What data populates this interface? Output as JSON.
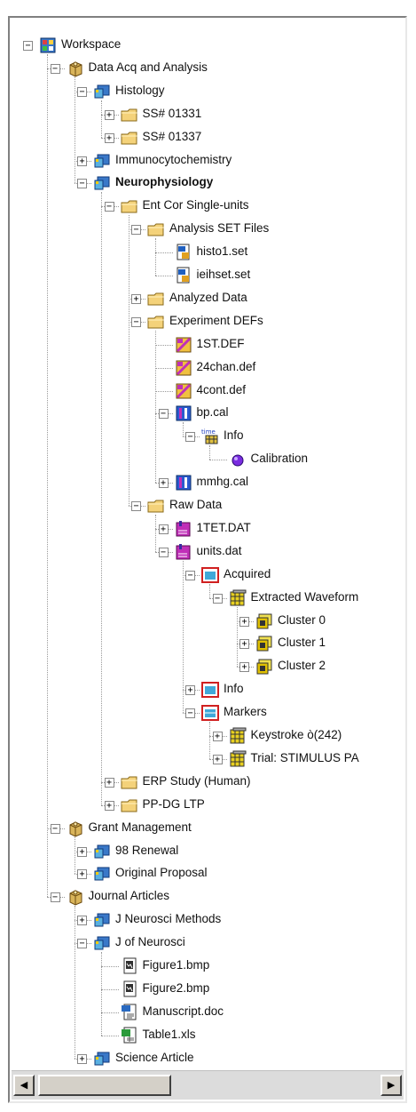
{
  "tree": {
    "nodes": [
      {
        "label": "Workspace",
        "icon": "workspace-icon",
        "expander": "minus"
      },
      {
        "label": "Data Acq and Analysis",
        "icon": "project-box-icon",
        "expander": "minus"
      },
      {
        "label": "Histology",
        "icon": "study-icon",
        "expander": "minus"
      },
      {
        "label": "SS# 01331",
        "icon": "folder-icon",
        "expander": "plus"
      },
      {
        "label": "SS# 01337",
        "icon": "folder-icon",
        "expander": "plus"
      },
      {
        "label": "Immunocytochemistry",
        "icon": "study-icon",
        "expander": "plus"
      },
      {
        "label": "Neurophysiology",
        "icon": "study-icon",
        "expander": "minus",
        "bold": true
      },
      {
        "label": "Ent Cor Single-units",
        "icon": "folder-icon",
        "expander": "minus"
      },
      {
        "label": "Analysis SET Files",
        "icon": "folder-icon",
        "expander": "minus"
      },
      {
        "label": "histo1.set",
        "icon": "set-file-icon"
      },
      {
        "label": "ieihset.set",
        "icon": "set-file-icon"
      },
      {
        "label": "Analyzed Data",
        "icon": "folder-icon",
        "expander": "plus"
      },
      {
        "label": "Experiment DEFs",
        "icon": "folder-icon",
        "expander": "minus"
      },
      {
        "label": "1ST.DEF",
        "icon": "def-file-icon"
      },
      {
        "label": "24chan.def",
        "icon": "def-file-icon"
      },
      {
        "label": "4cont.def",
        "icon": "def-file-icon"
      },
      {
        "label": "bp.cal",
        "icon": "cal-file-icon",
        "expander": "minus"
      },
      {
        "label": "Info",
        "icon": "time-info-icon",
        "expander": "minus",
        "badge": "time"
      },
      {
        "label": "Calibration",
        "icon": "calibration-dot-icon"
      },
      {
        "label": "mmhg.cal",
        "icon": "cal-file-icon",
        "expander": "plus"
      },
      {
        "label": "Raw Data",
        "icon": "folder-icon",
        "expander": "minus"
      },
      {
        "label": "1TET.DAT",
        "icon": "dat-file-icon",
        "expander": "plus"
      },
      {
        "label": "units.dat",
        "icon": "dat-file-icon",
        "expander": "minus"
      },
      {
        "label": "Acquired",
        "icon": "acquired-icon",
        "expander": "minus"
      },
      {
        "label": "Extracted Waveform",
        "icon": "grid-icon",
        "expander": "minus"
      },
      {
        "label": "Cluster 0",
        "icon": "cluster-icon",
        "expander": "plus"
      },
      {
        "label": "Cluster 1",
        "icon": "cluster-icon",
        "expander": "plus"
      },
      {
        "label": "Cluster 2",
        "icon": "cluster-icon",
        "expander": "plus"
      },
      {
        "label": "Info",
        "icon": "info-window-icon",
        "expander": "plus"
      },
      {
        "label": "Markers",
        "icon": "markers-icon",
        "expander": "minus"
      },
      {
        "label": "Keystroke ò(242)",
        "icon": "grid-icon",
        "expander": "plus"
      },
      {
        "label": "Trial: STIMULUS PA",
        "icon": "grid-icon",
        "expander": "plus"
      },
      {
        "label": "ERP Study (Human)",
        "icon": "folder-icon",
        "expander": "plus"
      },
      {
        "label": "PP-DG LTP",
        "icon": "folder-icon",
        "expander": "plus"
      },
      {
        "label": "Grant Management",
        "icon": "project-box-icon",
        "expander": "minus"
      },
      {
        "label": "98 Renewal",
        "icon": "study-icon",
        "expander": "plus"
      },
      {
        "label": "Original Proposal",
        "icon": "study-icon",
        "expander": "plus"
      },
      {
        "label": "Journal Articles",
        "icon": "project-box-icon",
        "expander": "minus"
      },
      {
        "label": "J Neurosci Methods",
        "icon": "study-icon",
        "expander": "plus"
      },
      {
        "label": "J of Neurosci",
        "icon": "study-icon",
        "expander": "minus"
      },
      {
        "label": "Figure1.bmp",
        "icon": "bmp-file-icon"
      },
      {
        "label": "Figure2.bmp",
        "icon": "bmp-file-icon"
      },
      {
        "label": "Manuscript.doc",
        "icon": "doc-file-icon"
      },
      {
        "label": "Table1.xls",
        "icon": "xls-file-icon"
      },
      {
        "label": "Science Article",
        "icon": "study-icon",
        "expander": "plus"
      }
    ]
  },
  "scrollbar": {
    "left_arrow": "◀",
    "right_arrow": "▶"
  },
  "colors": {
    "folder": "#f4d27a",
    "study": "#3a78c8",
    "accent_magenta": "#c02fb8",
    "calibration": "#7a2ce0"
  }
}
